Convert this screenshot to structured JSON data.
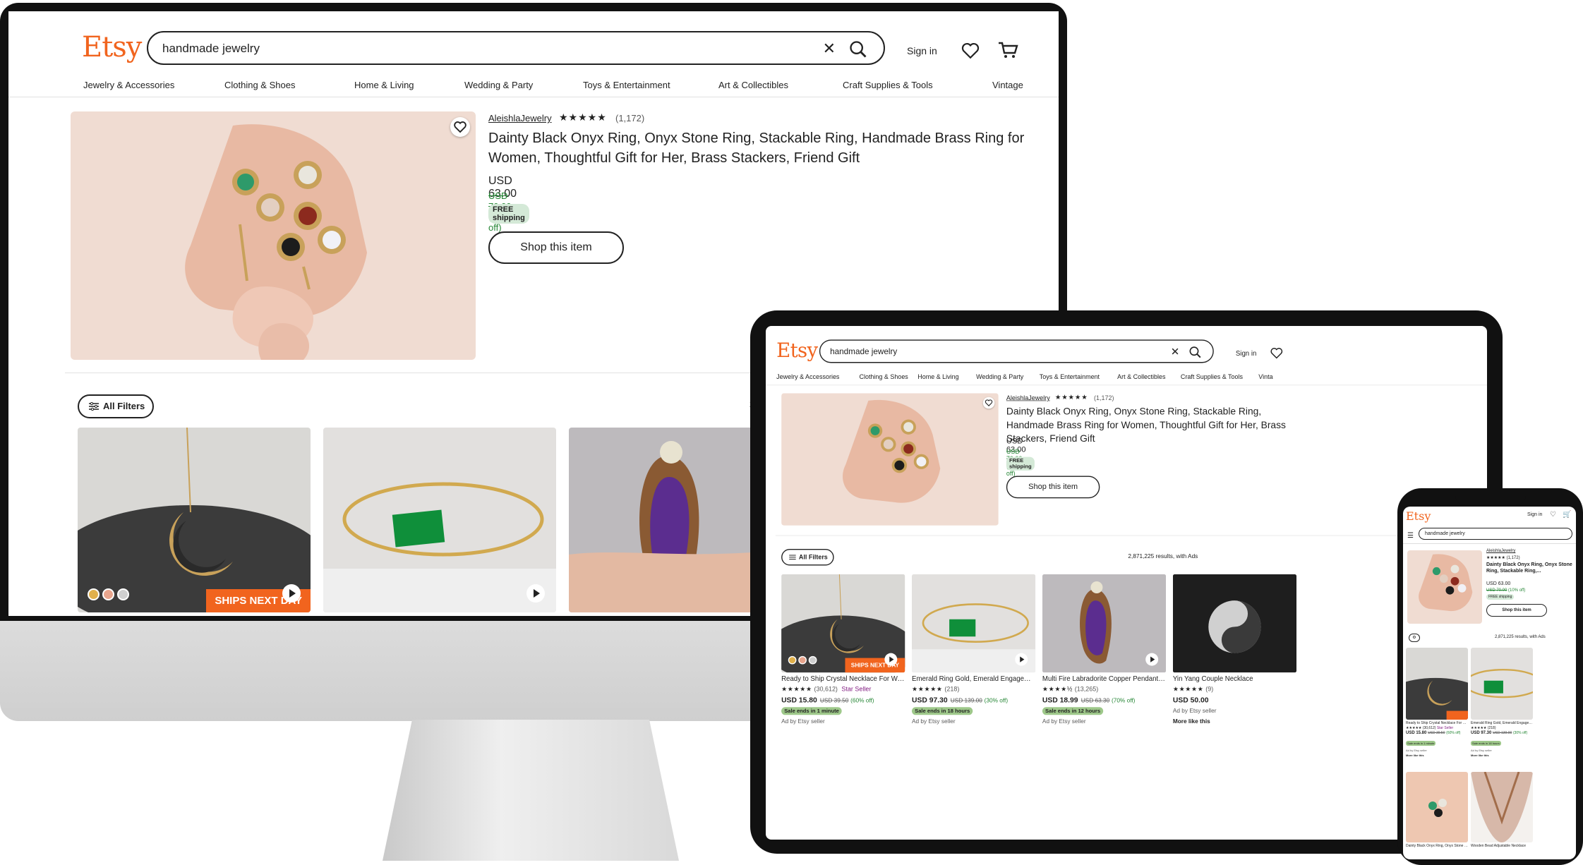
{
  "logo": "Etsy",
  "search": {
    "query": "handmade jewelry"
  },
  "signin": "Sign in",
  "nav": [
    "Jewelry & Accessories",
    "Clothing & Shoes",
    "Home & Living",
    "Wedding & Party",
    "Toys & Entertainment",
    "Art & Collectibles",
    "Craft Supplies & Tools",
    "Vintage"
  ],
  "nav_short_last": "Vinta",
  "featured": {
    "shop_name": "AleishlaJewelry",
    "stars": "★★★★★",
    "review_count": "(1,172)",
    "title": "Dainty Black Onyx Ring, Onyx Stone Ring, Stackable Ring, Handmade Brass Ring for Women, Thoughtful Gift for Her, Brass Stackers, Friend Gift",
    "title_short": "Dainty Black Onyx Ring, Onyx Stone Ring, Stackable Ring,...",
    "price": "USD 63.00",
    "original_price": "USD 70.00",
    "discount": "(10% off)",
    "shipping": "FREE shipping",
    "cta": "Shop this item"
  },
  "filters": {
    "label": "All Filters",
    "results": "2,871,225 results, with Ads",
    "results_short": "2,871,225 results, with Ads",
    "results_partial": "2"
  },
  "listings": [
    {
      "title": "Ready to Ship Crystal Necklace For Women Birthday Gift",
      "stars": "★★★★★",
      "count": "(30,612)",
      "badge": "Star Seller",
      "price": "USD 15.80",
      "orig": "USD 39.50",
      "off": "(60% off)",
      "sale": "Sale ends in 1 minute",
      "ad": "Ad by Etsy seller",
      "ships": "SHIPS NEXT DAY",
      "more": "More like this"
    },
    {
      "title": "Emerald Ring Gold, Emerald Engagement Ring, Dainty Ring",
      "stars": "★★★★★",
      "count": "(218)",
      "badge": "",
      "price": "USD 97.30",
      "orig": "USD 139.00",
      "off": "(30% off)",
      "sale": "Sale ends in 18 hours",
      "ad": "Ad by Etsy seller",
      "ships": "",
      "more": "More like this"
    },
    {
      "title": "Multi Fire Labradorite Copper Pendant Copper Wire Wrapped",
      "stars": "★★★★½",
      "count": "(13,265)",
      "badge": "",
      "price": "USD 18.99",
      "orig": "USD 63.30",
      "off": "(70% off)",
      "sale": "Sale ends in 12 hours",
      "ad": "Ad by Etsy seller",
      "ships": "",
      "more": ""
    },
    {
      "title": "Yin Yang Couple Necklace",
      "stars": "★★★★★",
      "count": "(9)",
      "badge": "",
      "price": "USD 50.00",
      "orig": "",
      "off": "",
      "sale": "",
      "ad": "Ad by Etsy seller",
      "ships": "",
      "more": "More like this"
    }
  ],
  "phone_bottom": [
    "Dainty Black Onyx Ring, Onyx Stone Ring",
    "Wooden Bead Adjustable Necklace"
  ],
  "icons": {
    "search": "search-icon",
    "clear": "close-icon",
    "heart": "heart-icon",
    "cart": "cart-icon",
    "filter": "filter-icon",
    "play": "play-icon",
    "menu": "menu-icon"
  },
  "colors": {
    "brand": "#F1641E",
    "sale_green": "#258635",
    "sale_badge": "#9EC88A",
    "star_seller": "#7F187F"
  }
}
